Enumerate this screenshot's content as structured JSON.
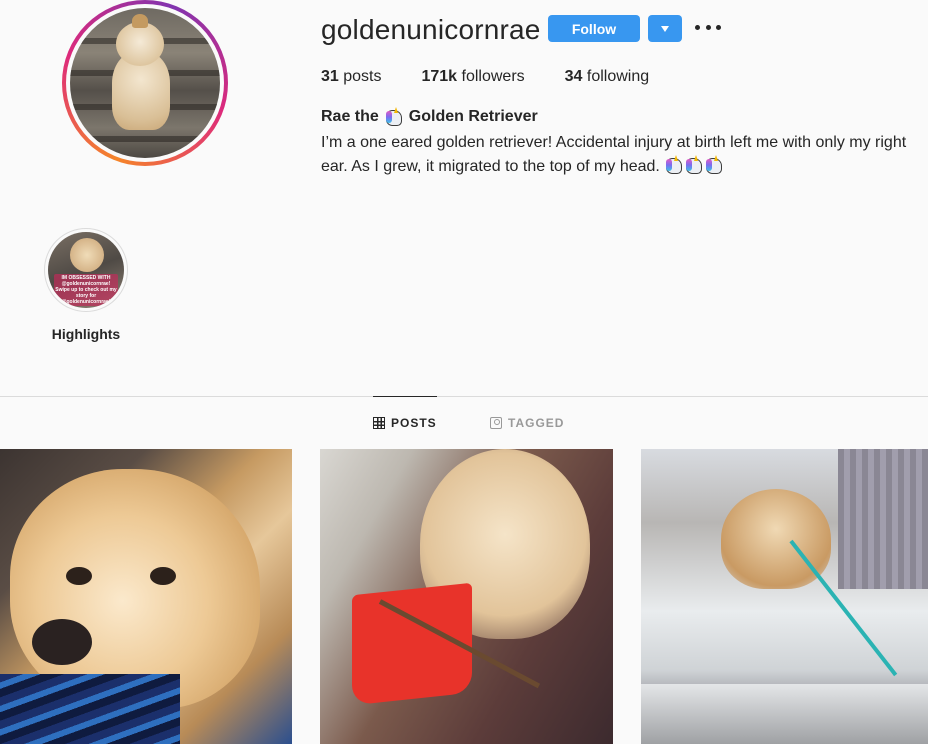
{
  "profile": {
    "username": "goldenunicornrae",
    "follow_label": "Follow",
    "stats": {
      "posts_count": "31",
      "posts_label": " posts",
      "followers_count": "171k",
      "followers_label": " followers",
      "following_count": "34",
      "following_label": " following"
    },
    "bio": {
      "name_prefix": "Rae the",
      "name_suffix": "Golden Retriever",
      "text": "I’m a one eared golden retriever! Accidental injury at birth left me with only my right ear. As I grew, it migrated to the top of my head."
    }
  },
  "highlights": [
    {
      "label": "Highlights",
      "overlay_text": "IM OBSESSED WITH @goldenunicornrae! Swipe up to check out my story for @goldenunicornrae!"
    }
  ],
  "tabs": [
    {
      "label": "POSTS",
      "active": true
    },
    {
      "label": "TAGGED",
      "active": false
    }
  ],
  "colors": {
    "follow_button": "#3897f0",
    "text": "#262626",
    "muted": "#999999"
  },
  "icons": [
    "more-options-icon",
    "dropdown-arrow-icon",
    "grid-icon",
    "tagged-icon",
    "unicorn-emoji-icon"
  ]
}
